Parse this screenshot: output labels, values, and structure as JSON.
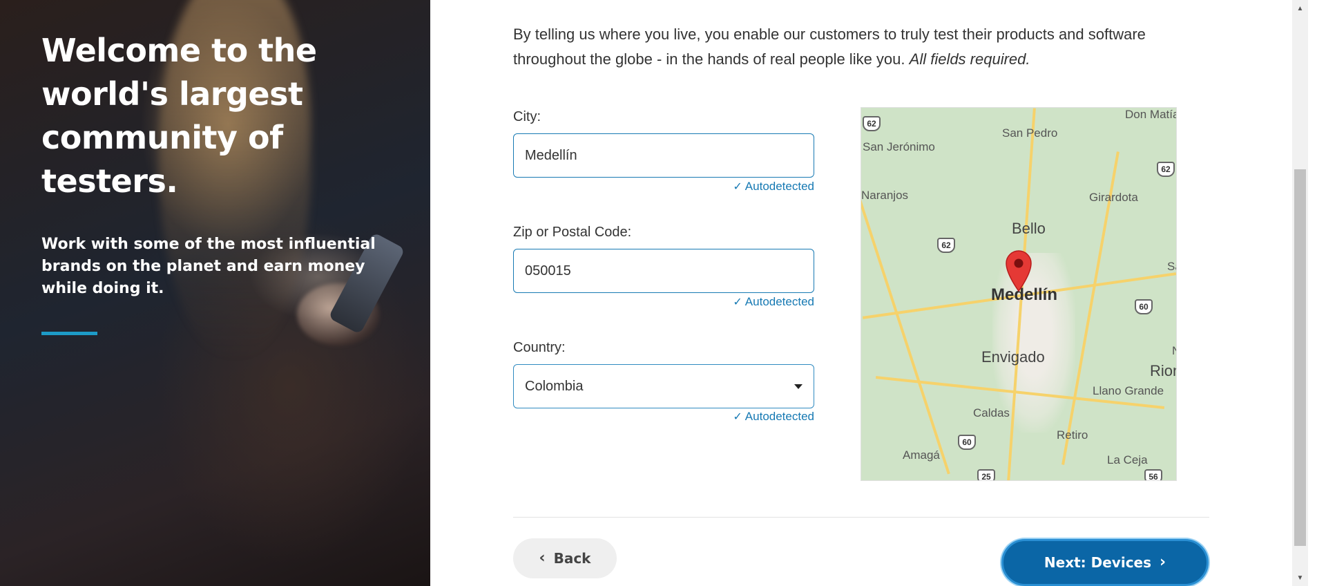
{
  "hero": {
    "title": "Welcome to the world's largest community of testers.",
    "subtitle": "Work with some of the most influential brands on the planet and earn money while doing it.",
    "accent_color": "#1d9bc7"
  },
  "intro": {
    "text": "By telling us where you live, you enable our customers to truly test their products and software throughout the globe - in the hands of real people like you.",
    "required_note": "All fields required."
  },
  "form": {
    "city": {
      "label": "City:",
      "value": "Medellín",
      "status": "Autodetected"
    },
    "zip": {
      "label": "Zip or Postal Code:",
      "value": "050015",
      "status": "Autodetected"
    },
    "country": {
      "label": "Country:",
      "value": "Colombia",
      "status": "Autodetected"
    }
  },
  "map": {
    "center_label": "Medellín",
    "labels": [
      "Don Matía",
      "San Pedro",
      "San Jerónimo",
      "Naranjos",
      "Girardota",
      "Bello",
      "Envigado",
      "Rioneg",
      "Llano Grande",
      "Caldas",
      "Retiro",
      "Amagá",
      "La Ceja",
      "Sa",
      "N"
    ],
    "route_shields": [
      "62",
      "62",
      "62",
      "60",
      "60",
      "25",
      "56"
    ]
  },
  "nav": {
    "back_label": "Back",
    "next_label": "Next: Devices"
  },
  "icons": {
    "check": "check-icon",
    "caret": "caret-down-icon",
    "back": "chevron-left-icon",
    "next": "chevron-right-icon",
    "pin": "map-pin-icon"
  }
}
